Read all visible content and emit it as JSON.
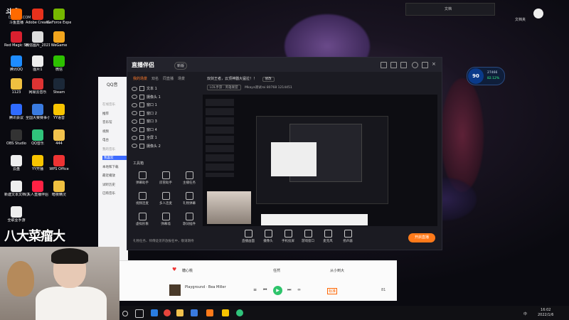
{
  "watermark": {
    "logo": "斗鱼",
    "site": "DOUYU.COM"
  },
  "streamer_name": "八大菜瘤大",
  "desktop_icons": [
    {
      "label": "斗鱼直播",
      "color": "#ff6a00"
    },
    {
      "label": "Adobe Creative...",
      "color": "#e8311c"
    },
    {
      "label": "GeForce Experience",
      "color": "#76b900"
    },
    {
      "label": "Red Magic Studio",
      "color": "#d9202f"
    },
    {
      "label": "微信图片_202112...",
      "color": "#ddd"
    },
    {
      "label": "WeGame",
      "color": "#f2a51d"
    },
    {
      "label": "腾讯QQ",
      "color": "#1e8cff"
    },
    {
      "label": "图片1",
      "color": "#eee"
    },
    {
      "label": "微信",
      "color": "#2dc100"
    },
    {
      "label": "1123",
      "color": "#f0c040"
    },
    {
      "label": "网易云音乐",
      "color": "#d33"
    },
    {
      "label": "Steam",
      "color": "#1b2838"
    },
    {
      "label": "腾讯会议",
      "color": "#2f6bff"
    },
    {
      "label": "全国大赛赛事小组积...",
      "color": "#3a7be0"
    },
    {
      "label": "YY语音",
      "color": "#f8c400"
    },
    {
      "label": "OBS Studio",
      "color": "#333"
    },
    {
      "label": "QQ音乐",
      "color": "#30c37b"
    },
    {
      "label": "444",
      "color": "#f2c24d"
    },
    {
      "label": "云盘",
      "color": "#eee"
    },
    {
      "label": "YY开播",
      "color": "#f8c400"
    },
    {
      "label": "WPS Office",
      "color": "#e33"
    },
    {
      "label": "新建文本文档(3)",
      "color": "#eee"
    },
    {
      "label": "夫人直播伴侣",
      "color": "#f24"
    },
    {
      "label": "暗夜精灵",
      "color": "#f0c040"
    },
    {
      "label": "全职业手游",
      "color": "#eee"
    }
  ],
  "top_window": {
    "label": "文档"
  },
  "top_right_label": "文档夹",
  "app": {
    "logo": "直播伴侣",
    "version": "新版",
    "scene_tabs": [
      "我的场景",
      "双名",
      "同直播",
      "场景"
    ],
    "sources": [
      {
        "label": "文本 1"
      },
      {
        "label": "摄像头 1"
      },
      {
        "label": "窗口 1"
      },
      {
        "label": "窗口 2"
      },
      {
        "label": "窗口 3"
      },
      {
        "label": "窗口 4"
      },
      {
        "label": "全屏 1"
      },
      {
        "label": "摄像头 2"
      }
    ],
    "tools_header": "工具箱",
    "tools": [
      {
        "label": "弹幕助手"
      },
      {
        "label": "房管助手"
      },
      {
        "label": "主播任务"
      },
      {
        "label": "视频连麦"
      },
      {
        "label": "多人连麦"
      },
      {
        "label": "礼物弹幕"
      },
      {
        "label": "虚拟形象"
      },
      {
        "label": "弹幕墙"
      },
      {
        "label": "歌词插件"
      }
    ],
    "notice": "礼物任务、师傅徒弟开放报名中，敬请期待",
    "room_title": "双剑王者，云顶神器大猛拉！！",
    "room_tag": "LOL手游 · 英雄联盟",
    "room_meta": "Mkaya测试roi   80768   1214451",
    "room_btn": "修改",
    "bottom_tools": [
      {
        "label": "直播画面"
      },
      {
        "label": "摄像头"
      },
      {
        "label": "手机投屏"
      },
      {
        "label": "游戏窗口"
      },
      {
        "label": "麦克风"
      },
      {
        "label": "扬声器"
      }
    ],
    "start_button": "开启直播"
  },
  "qq": {
    "title": "QQ音",
    "items": [
      {
        "label": "在线音乐",
        "section": true
      },
      {
        "label": "推荐"
      },
      {
        "label": "音乐馆"
      },
      {
        "label": "视频"
      },
      {
        "label": "电台"
      },
      {
        "label": "我的音乐",
        "section": true
      },
      {
        "label": "我喜欢",
        "selected": true
      },
      {
        "label": "本地和下载"
      },
      {
        "label": "最近播放"
      },
      {
        "label": "试听历史"
      },
      {
        "label": "已购音乐"
      }
    ]
  },
  "music": {
    "lyric_left": "糖心桃",
    "lyric_mid": "任然",
    "lyric_right": "从小到大",
    "song": "Playground · Bea Miller",
    "play_symbol": "▶",
    "volume_label": "标准",
    "queue_count": "81"
  },
  "game_widget": {
    "score": "90",
    "line1": "27466",
    "line2": "82.12%"
  },
  "taskbar": {
    "time": "16:02",
    "date": "2022/1/6",
    "lang": "中"
  }
}
